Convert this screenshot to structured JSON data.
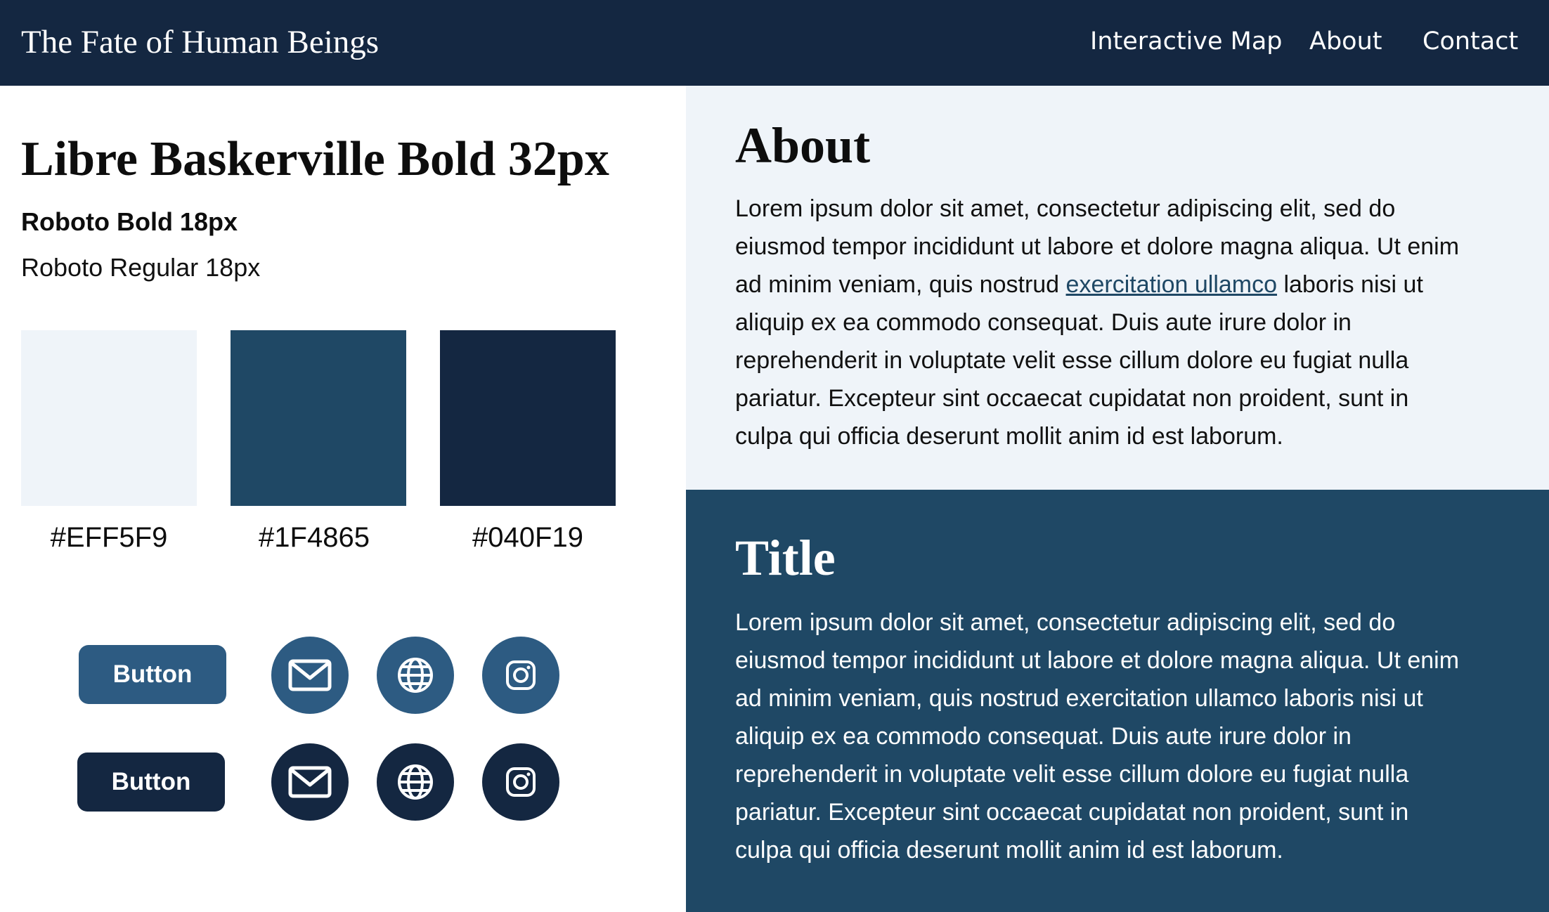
{
  "header": {
    "brand": "The Fate of Human Beings",
    "nav": [
      "Interactive Map",
      "About",
      "Contact"
    ]
  },
  "style_guide": {
    "heading_sample": "Libre Baskerville Bold 32px",
    "bold_sample": "Roboto Bold 18px",
    "regular_sample": "Roboto Regular 18px",
    "swatches": [
      {
        "label": "#EFF5F9",
        "color": "#EFF5F9"
      },
      {
        "label": "#1F4865",
        "color": "#1F4865"
      },
      {
        "label": "#040F19",
        "color": "#142741"
      }
    ],
    "buttons": [
      {
        "label": "Button",
        "color": "#2d5b82"
      },
      {
        "label": "Button",
        "color": "#142741"
      }
    ],
    "icons": [
      "mail-icon",
      "globe-icon",
      "instagram-icon"
    ]
  },
  "about": {
    "heading": "About",
    "body_before_link": "Lorem ipsum dolor sit amet, consectetur adipiscing elit, sed do\neiusmod tempor incididunt ut labore et dolore magna aliqua. Ut enim\nad minim veniam, quis nostrud ",
    "link_text": "exercitation ullamco",
    "body_after_link": " laboris nisi ut\naliquip ex ea commodo consequat. Duis aute irure dolor in\nreprehenderit in voluptate velit esse cillum dolore eu fugiat nulla\npariatur. Excepteur sint occaecat cupidatat non proident, sunt in\nculpa qui officia deserunt mollit anim id est laborum."
  },
  "title_section": {
    "heading": "Title",
    "body": "Lorem ipsum dolor sit amet, consectetur adipiscing elit, sed do\neiusmod tempor incididunt ut labore et dolore magna aliqua. Ut enim\nad minim veniam, quis nostrud exercitation ullamco laboris nisi ut\naliquip ex ea commodo consequat. Duis aute irure dolor in\nreprehenderit in voluptate velit esse cillum dolore eu fugiat nulla\npariatur. Excepteur sint occaecat cupidatat non proident, sunt in\nculpa qui officia deserunt mollit anim id est laborum."
  },
  "colors": {
    "nav_bg": "#142741",
    "light_bg": "#eff4f9",
    "mid_blue": "#1f4865",
    "accent_button": "#2d5b82"
  }
}
